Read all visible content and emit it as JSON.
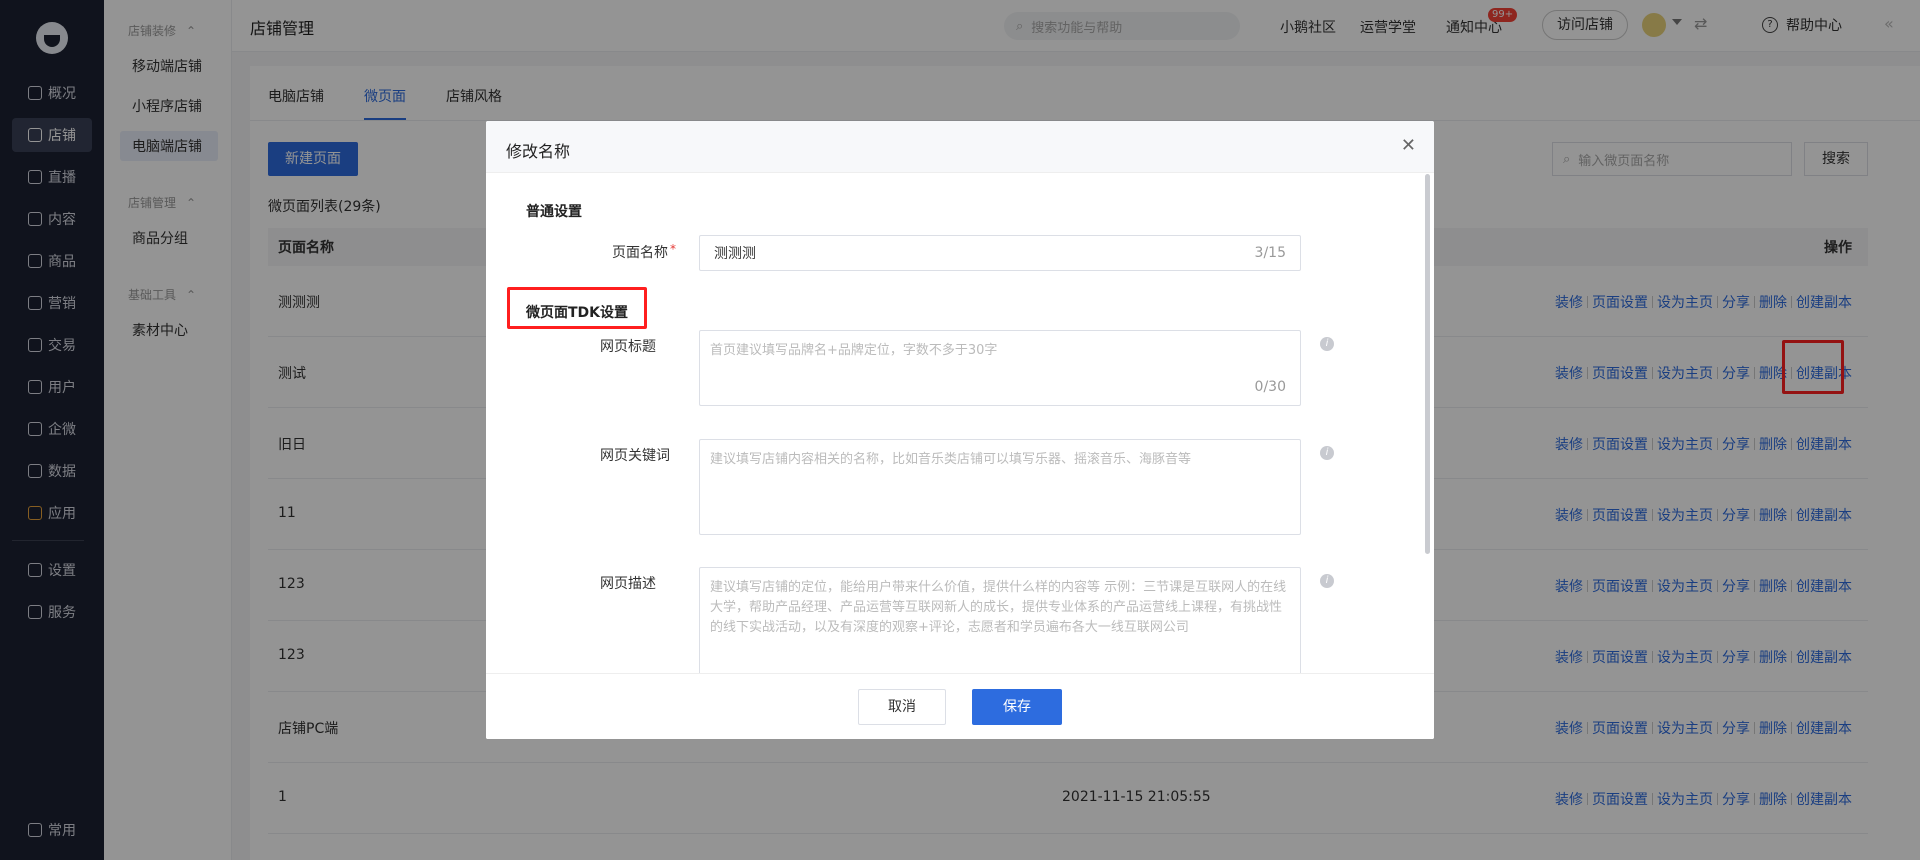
{
  "nav": {
    "items": [
      {
        "label": "概况",
        "icon": "pie-chart-icon"
      },
      {
        "label": "店铺",
        "icon": "store-icon"
      },
      {
        "label": "直播",
        "icon": "live-icon"
      },
      {
        "label": "内容",
        "icon": "document-icon"
      },
      {
        "label": "商品",
        "icon": "goods-icon"
      },
      {
        "label": "营销",
        "icon": "megaphone-icon"
      },
      {
        "label": "交易",
        "icon": "trade-icon"
      },
      {
        "label": "用户",
        "icon": "user-icon"
      },
      {
        "label": "企微",
        "icon": "wecom-icon"
      },
      {
        "label": "数据",
        "icon": "data-icon"
      },
      {
        "label": "应用",
        "icon": "apps-icon"
      }
    ],
    "bottom_items": [
      {
        "label": "设置",
        "icon": "gear-icon"
      },
      {
        "label": "服务",
        "icon": "service-icon"
      }
    ],
    "footer_label": "常用"
  },
  "subnav": {
    "groups": [
      {
        "title": "店铺装修",
        "items": [
          "移动端店铺",
          "小程序店铺",
          "电脑端店铺"
        ]
      },
      {
        "title": "店铺管理",
        "items": [
          "商品分组"
        ]
      },
      {
        "title": "基础工具",
        "items": [
          "素材中心"
        ]
      }
    ]
  },
  "topbar": {
    "title": "店铺管理",
    "search_placeholder": "搜索功能与帮助",
    "links": [
      "小鹅社区",
      "运营学堂",
      "通知中心"
    ],
    "notification_badge": "99+",
    "visit_store": "访问店铺",
    "help": "帮助中心"
  },
  "main": {
    "tabs": [
      "电脑店铺",
      "微页面",
      "店铺风格"
    ],
    "new_page_button": "新建页面",
    "search_placeholder": "输入微页面名称",
    "search_button": "搜索",
    "list_count": "微页面列表(29条)",
    "columns": {
      "name": "页面名称",
      "ops": "操作"
    },
    "rows": [
      {
        "name": "测测测",
        "time": ""
      },
      {
        "name": "测试",
        "time": ""
      },
      {
        "name": "旧日",
        "time": ""
      },
      {
        "name": "11",
        "time": ""
      },
      {
        "name": "123",
        "time": ""
      },
      {
        "name": "123",
        "time": ""
      },
      {
        "name": "店铺PC端",
        "time": ""
      },
      {
        "name": "1",
        "time": "2021-11-15 21:05:55"
      }
    ],
    "ops": [
      "装修",
      "页面设置",
      "设为主页",
      "分享",
      "删除",
      "创建副本"
    ]
  },
  "modal": {
    "title": "修改名称",
    "section_general": "普通设置",
    "page_name_label": "页面名称",
    "page_name_value": "测测测",
    "page_name_count": "3/15",
    "section_tdk": "微页面TDK设置",
    "web_title_label": "网页标题",
    "web_title_placeholder": "首页建议填写品牌名+品牌定位，字数不多于30字",
    "web_title_count": "0/30",
    "keywords_label": "网页关键词",
    "keywords_placeholder": "建议填写店铺内容相关的名称，比如音乐类店铺可以填写乐器、摇滚音乐、海豚音等",
    "desc_label": "网页描述",
    "desc_placeholder": "建议填写店铺的定位，能给用户带来什么价值，提供什么样的内容等 示例：三节课是互联网人的在线大学，帮助产品经理、产品运营等互联网新人的成长，提供专业体系的产品运营线上课程，有挑战性的线下实战活动，以及有深度的观察+评论，志愿者和学员遍布各大一线互联网公司",
    "cancel": "取消",
    "save": "保存"
  },
  "colors": {
    "primary": "#2d6cdf",
    "sidebar": "#1d2232",
    "highlight": "#ff1f1f"
  }
}
